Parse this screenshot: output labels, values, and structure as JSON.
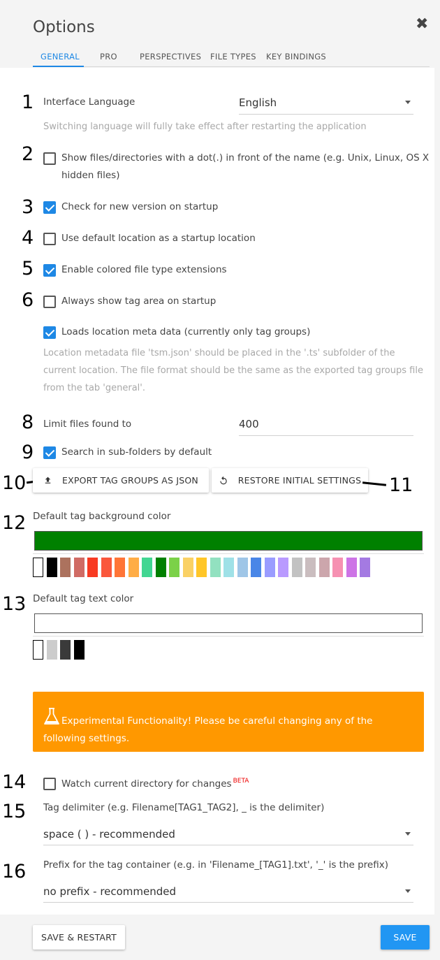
{
  "dialog": {
    "title": "Options",
    "close_icon": "✖"
  },
  "tabs": [
    {
      "label": "GENERAL",
      "active": true
    },
    {
      "label": "PRO",
      "active": false
    },
    {
      "label": "PERSPECTIVES",
      "active": false
    },
    {
      "label": "FILE TYPES",
      "active": false
    },
    {
      "label": "KEY BINDINGS",
      "active": false
    }
  ],
  "annotations": [
    "1",
    "2",
    "3",
    "4",
    "5",
    "6",
    "8",
    "9",
    "10",
    "11",
    "12",
    "13",
    "14",
    "15",
    "16"
  ],
  "settings": {
    "language": {
      "label": "Interface Language",
      "value": "English",
      "help": "Switching language will fully take effect after restarting the application"
    },
    "show_hidden": {
      "label_line1": "Show files/directories with a dot(.) in front of the name (e.g. Unix, Linux, OS X",
      "label_line2": "hidden files)",
      "checked": false
    },
    "check_version": {
      "label": "Check for new version on startup",
      "checked": true
    },
    "default_location": {
      "label": "Use default location as a startup location",
      "checked": false
    },
    "colored_ext": {
      "label": "Enable colored file type extensions",
      "checked": true
    },
    "tag_area": {
      "label": "Always show tag area on startup",
      "checked": false
    },
    "location_meta": {
      "label": "Loads location meta data (currently only tag groups)",
      "checked": true,
      "help_line1": "Location metadata file 'tsm.json' should be placed in the '.ts' subfolder of the",
      "help_line2": "current location. The file format should be the same as the exported tag groups file",
      "help_line3": "from the tab 'general'."
    },
    "limit_files": {
      "label": "Limit files found to",
      "value": "400"
    },
    "search_subfolders": {
      "label": "Search in sub-folders by default",
      "checked": true
    },
    "export_button": "EXPORT TAG GROUPS AS JSON",
    "restore_button": "RESTORE INITIAL SETTINGS",
    "tag_bg_color": {
      "label": "Default tag background color",
      "value": "#008000"
    },
    "tag_bg_swatches": [
      "#ffffff",
      "#000000",
      "#ac725e",
      "#d06b64",
      "#f83a22",
      "#fa573c",
      "#ff7537",
      "#ffad46",
      "#42d692",
      "#008000",
      "#7bd148",
      "#fad165",
      "#ffc628",
      "#92e1c0",
      "#9fe1e7",
      "#9fc6e7",
      "#4986e7",
      "#9a9cff",
      "#b99aff",
      "#c2c2c2",
      "#cabdbf",
      "#cca6ac",
      "#f691b2",
      "#cd74e6",
      "#a47ae2"
    ],
    "tag_text_color": {
      "label": "Default tag text color",
      "value": "#ffffff"
    },
    "tag_text_swatches": [
      "#ffffff",
      "#cccccc",
      "#3a3a3a",
      "#000000"
    ],
    "warning": "Experimental Functionality! Please be careful changing any of the following settings.",
    "watch_dir": {
      "label": "Watch current directory for changes",
      "badge": "BETA",
      "checked": false
    },
    "tag_delimiter": {
      "label": "Tag delimiter (e.g. Filename[TAG1_TAG2], _ is the delimiter)",
      "value": "space (  ) - recommended"
    },
    "prefix": {
      "label": "Prefix for the tag container (e.g. in 'Filename_[TAG1].txt', '_' is the prefix)",
      "value": "no prefix - recommended"
    }
  },
  "footer": {
    "save_restart": "SAVE & RESTART",
    "save": "SAVE"
  },
  "colors": {
    "accent": "#2196f3",
    "warning": "#ff9800",
    "beta": "#ee0000"
  }
}
